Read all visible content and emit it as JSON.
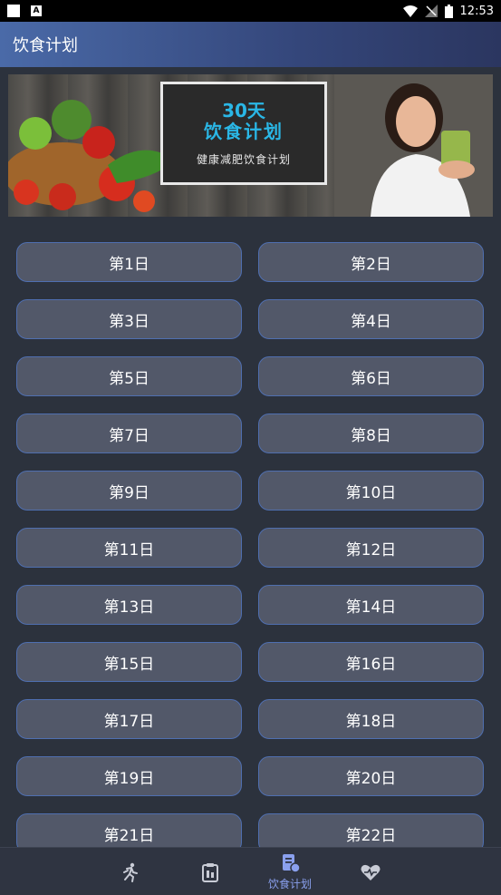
{
  "status_bar": {
    "time": "12:53"
  },
  "app_bar": {
    "title": "饮食计划"
  },
  "banner": {
    "line1": "30天",
    "line2": "饮食计划",
    "line3": "健康减肥饮食计划"
  },
  "days": [
    "第1日",
    "第2日",
    "第3日",
    "第4日",
    "第5日",
    "第6日",
    "第7日",
    "第8日",
    "第9日",
    "第10日",
    "第11日",
    "第12日",
    "第13日",
    "第14日",
    "第15日",
    "第16日",
    "第17日",
    "第18日",
    "第19日",
    "第20日",
    "第21日",
    "第22日"
  ],
  "nav": {
    "active_label": "饮食计划",
    "icons": [
      "running-icon",
      "clipboard-icon",
      "diet-plan-icon",
      "heart-icon"
    ],
    "accent": "#8aa0ee"
  }
}
